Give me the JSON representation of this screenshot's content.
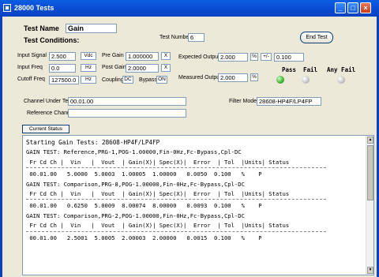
{
  "window": {
    "title": "28000 Tests"
  },
  "test_name": {
    "label": "Test Name",
    "value": "Gain"
  },
  "test_conditions_label": "Test Conditions:",
  "test_number": {
    "label": "Test Number",
    "value": "6"
  },
  "end_test_label": "End Test",
  "input_signal": {
    "label": "Input Signal",
    "value": "2.500",
    "unit": "Vdc"
  },
  "input_freq": {
    "label": "Input Freq",
    "value": "0.0",
    "unit": "Hz"
  },
  "cutoff_freq": {
    "label": "Cutoff Freq",
    "value": "127500.0",
    "unit": "Hz"
  },
  "pre_gain": {
    "label": "Pre Gain",
    "value": "1.000000",
    "unit": "X"
  },
  "post_gain": {
    "label": "Post Gain",
    "value": "2.0000",
    "unit": "X"
  },
  "coupling": {
    "label": "Coupling",
    "value": "DC"
  },
  "bypass": {
    "label": "Bypass",
    "value": "ON"
  },
  "expected_output": {
    "label": "Expected Output",
    "value": "2.000",
    "unit": "%",
    "tol_sign": "+/-",
    "tol_value": "0.100"
  },
  "measured_output": {
    "label": "Measured Output",
    "value": "2.000",
    "unit": "%"
  },
  "status_lights": {
    "pass": "Pass",
    "fail": "Fail",
    "any_fail": "Any Fail"
  },
  "channel_under_test": {
    "label": "Channel Under Test",
    "value": "00.01.00"
  },
  "filter_model": {
    "label": "Filter Model",
    "value": "28608-HP4F/LP4FP"
  },
  "reference_channel": {
    "label": "Reference Channel",
    "value": ""
  },
  "current_status_label": "Current Status",
  "log": {
    "header": "Starting Gain Tests: 28608-HP4F/LP4FP",
    "blocks": [
      {
        "title": "GAIN TEST: Reference,PRG-1,POG-1.00000,Fin-0Hz,Fc-Bypass,Cpl-DC",
        "columns": " Fr Cd Ch |  Vin   |  Vout  | Gain(X)| Spec(X)|  Error  | Tol  |Units| Status",
        "row": " 00.01.00   5.0000  5.0003  1.00005  1.00000   0.0050  0.100   %    P"
      },
      {
        "title": "GAIN TEST: Comparison,PRG-8,POG-1.00000,Fin-0Hz,Fc-Bypass,Cpl-DC",
        "columns": " Fr Cd Ch |  Vin   |  Vout  | Gain(X)| Spec(X)|  Error  | Tol  |Units| Status",
        "row": " 00.01.00   0.6250  5.0009  8.00074  8.00000   0.0093  0.100   %    P"
      },
      {
        "title": "GAIN TEST: Comparison,PRG-2,POG-1.00000,Fin-0Hz,Fc-Bypass,Cpl-DC",
        "columns": " Fr Cd Ch |  Vin   |  Vout  | Gain(X)| Spec(X)|  Error  | Tol  |Units| Status",
        "row": " 00.01.00   2.5001  5.0005  2.00003  2.00000   0.0015  0.100   %    P"
      }
    ]
  }
}
